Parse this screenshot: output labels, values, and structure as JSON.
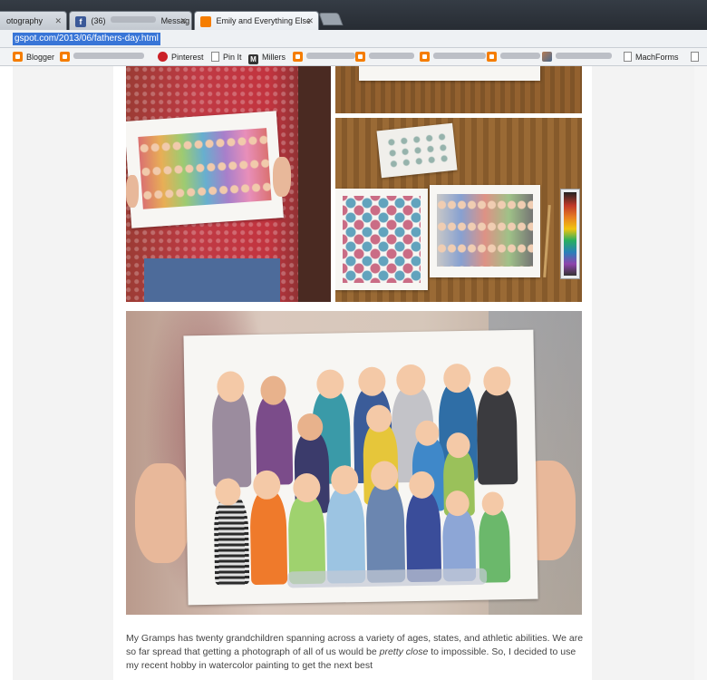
{
  "browser": {
    "tabs": [
      {
        "label": "otography",
        "favicon": "page-icon"
      },
      {
        "label": "(36)",
        "favicon": "facebook-icon",
        "suffix": "Messag"
      },
      {
        "label": "Emily and Everything Else",
        "favicon": "blogger-icon"
      }
    ],
    "url": "gspot.com/2013/06/fathers-day.html"
  },
  "bookmarks": [
    {
      "label": "Blogger",
      "icon": "blogger-icon"
    },
    {
      "label": "Pinterest",
      "icon": "pinterest-icon"
    },
    {
      "label": "Pin It",
      "icon": "page-icon"
    },
    {
      "label": "Millers",
      "icon": "m-icon"
    },
    {
      "label": "MachForms",
      "icon": "page-icon"
    }
  ],
  "post": {
    "text_before": "My Gramps has twenty grandchildren spanning across a variety of ages, states, and athletic abilities. We are so far spread that getting a photograph of all of us would be ",
    "text_em": "pretty close",
    "text_after": " to impossible. So, I decided to use my recent hobby in watercolor painting to get the next best"
  },
  "colors": {
    "tabstrip": "#2e343c",
    "selection": "#3875d7",
    "blogger": "#f57d00",
    "facebook": "#3b5998",
    "pinterest": "#cb2027"
  }
}
